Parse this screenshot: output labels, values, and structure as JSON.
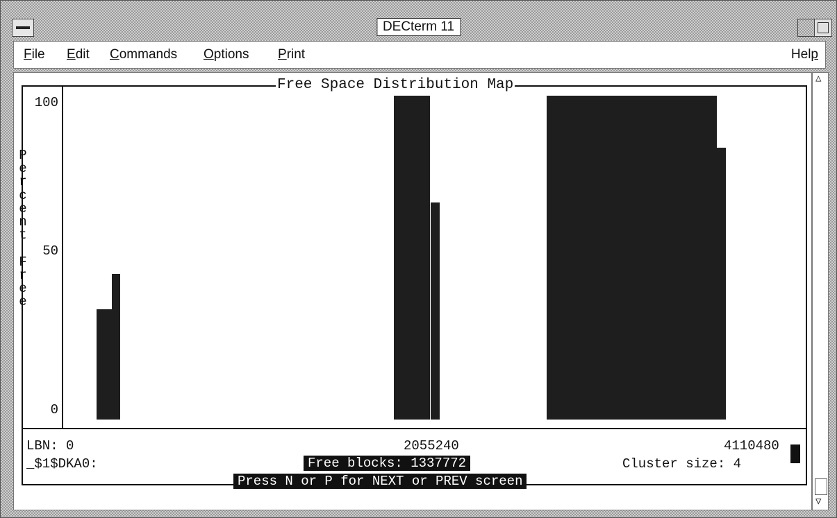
{
  "window": {
    "title": "DECterm 11"
  },
  "menubar": {
    "items": [
      {
        "label": "File"
      },
      {
        "label": "Edit"
      },
      {
        "label": "Commands"
      },
      {
        "label": "Options"
      },
      {
        "label": "Print"
      }
    ],
    "help_label": "Help"
  },
  "map": {
    "title": "Free Space Distribution Map",
    "y_axis_label": "Percent Free",
    "y_ticks": [
      "100",
      "50",
      "0"
    ],
    "bars": [
      {
        "x0": 0.045,
        "x1": 0.066,
        "value": 34
      },
      {
        "x0": 0.066,
        "x1": 0.078,
        "value": 45
      },
      {
        "x0": 0.45,
        "x1": 0.5,
        "value": 100
      },
      {
        "x0": 0.5,
        "x1": 0.513,
        "value": 67
      },
      {
        "x0": 0.658,
        "x1": 0.89,
        "value": 100
      },
      {
        "x0": 0.89,
        "x1": 0.903,
        "value": 84
      }
    ]
  },
  "status": {
    "lbn_start": "LBN: 0",
    "lbn_mid": "2055240",
    "lbn_end": "4110480",
    "device": "_$1$DKA0:",
    "free_blocks": "Free blocks: 1337772",
    "cluster_size": "Cluster size: 4",
    "prompt": "Press N or P for NEXT or PREV screen"
  }
}
